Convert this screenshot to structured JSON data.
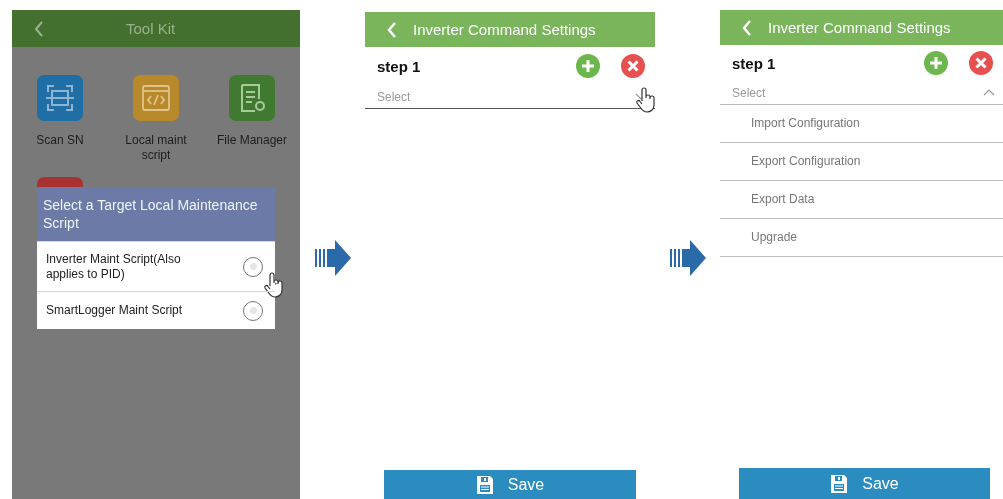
{
  "tool_kit_screen": {
    "title": "Tool Kit",
    "tools": [
      {
        "kind": "scan",
        "label": "Scan SN",
        "color": "#1f6ea6"
      },
      {
        "kind": "script",
        "label": "Local maint script",
        "color": "#b8892a"
      },
      {
        "kind": "file",
        "label": "File Manager",
        "color": "#3f7a30"
      },
      {
        "kind": "other",
        "color": "#a83232"
      }
    ],
    "dialog": {
      "title": "Select a Target Local Maintenance Script",
      "options": [
        {
          "label": "Inverter Maint Script(Also applies to PID)",
          "selected": false
        },
        {
          "label": "SmartLogger Maint Script",
          "selected": false
        }
      ]
    }
  },
  "command_screens": [
    {
      "title": "Inverter Command Settings",
      "step": "step 1",
      "select": {
        "placeholder": "Select",
        "expanded": false
      },
      "save": "Save"
    },
    {
      "title": "Inverter Command Settings",
      "step": "step 1",
      "select": {
        "placeholder": "Select",
        "expanded": true
      },
      "options": [
        "Import Configuration",
        "Export Configuration",
        "Export Data",
        "Upgrade"
      ],
      "save": "Save"
    }
  ]
}
